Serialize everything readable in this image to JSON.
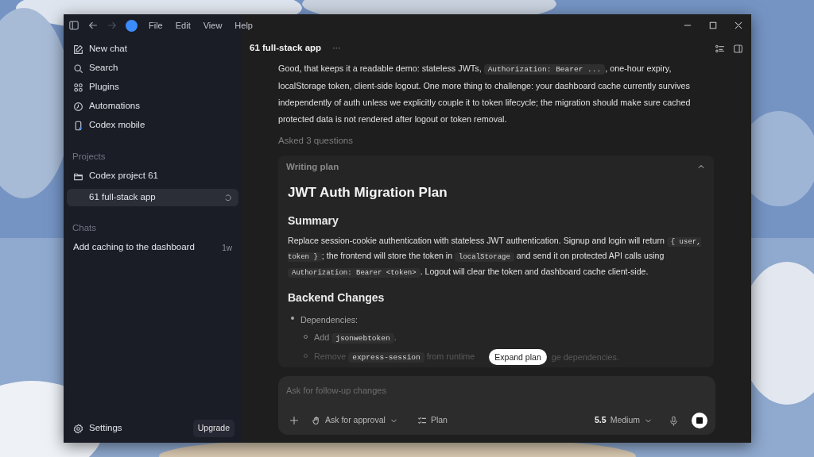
{
  "titlebar": {
    "nav_buttons": [
      {
        "kind": "back",
        "disabled": false
      },
      {
        "kind": "forward",
        "disabled": true
      }
    ],
    "menu": [
      "File",
      "Edit",
      "View",
      "Help"
    ]
  },
  "sidebar": {
    "items": [
      {
        "kind": "new-chat",
        "label": "New chat"
      },
      {
        "kind": "search",
        "label": "Search"
      },
      {
        "kind": "plugins",
        "label": "Plugins"
      },
      {
        "kind": "automations",
        "label": "Automations"
      },
      {
        "kind": "mobile",
        "label": "Codex mobile"
      }
    ],
    "projects": {
      "heading": "Projects",
      "items": [
        {
          "label": "Codex project 61",
          "selected": false,
          "children": [
            {
              "label": "61 full-stack app",
              "selected": true,
              "running": true
            }
          ]
        }
      ]
    },
    "chats": {
      "heading": "Chats",
      "items": [
        {
          "label": "Add caching to the dashboard",
          "time": "1w",
          "selected": false
        }
      ]
    },
    "settings": "Settings",
    "upgrade": "Upgrade"
  },
  "thread": {
    "title": "61 full-stack app",
    "more": "···",
    "message": [
      {
        "kind": "text",
        "text": "Good, that keeps it a readable demo: stateless JWTs, "
      },
      {
        "kind": "code",
        "text": "Authorization: Bearer ..."
      },
      {
        "kind": "text",
        "text": ", one-hour expiry, localStorage token, client-side logout. One more thing to challenge: your dashboard cache currently survives independently of auth unless we explicitly couple it to token lifecycle; the migration should make sure cached protected data is not rendered after logout or token removal."
      }
    ],
    "status": "Asked 3 questions",
    "plan": {
      "header": "Writing plan",
      "expand_button": "Expand plan",
      "blocks": [
        {
          "kind": "h1",
          "text": "JWT Auth Migration Plan"
        },
        {
          "kind": "h2",
          "text": "Summary"
        },
        {
          "kind": "p",
          "segments": [
            {
              "kind": "text",
              "text": "Replace session-cookie authentication with stateless JWT authentication. Signup and login will return "
            },
            {
              "kind": "code",
              "text": "{ user, token }"
            },
            {
              "kind": "text",
              "text": "; the frontend will store the token in "
            },
            {
              "kind": "code",
              "text": "localStorage"
            },
            {
              "kind": "text",
              "text": " and send it on protected API calls using "
            },
            {
              "kind": "code",
              "text": "Authorization: Bearer <token>"
            },
            {
              "kind": "text",
              "text": ". Logout will clear the token and dashboard cache client-side."
            }
          ]
        },
        {
          "kind": "h2",
          "text": "Backend Changes"
        },
        {
          "kind": "li",
          "segments": [
            {
              "kind": "text",
              "text": "Dependencies:"
            }
          ],
          "children": [
            {
              "segments": [
                {
                  "kind": "text",
                  "text": "Add "
                },
                {
                  "kind": "code",
                  "text": "jsonwebtoken"
                },
                {
                  "kind": "text",
                  "text": "."
                }
              ]
            },
            {
              "segments": [
                {
                  "kind": "text",
                  "text": "Remove "
                },
                {
                  "kind": "code",
                  "text": "express-session"
                },
                {
                  "kind": "text",
                  "text": " from runtime"
                }
              ],
              "tail": "ge dependencies."
            }
          ]
        }
      ]
    }
  },
  "composer": {
    "placeholder": "Ask for follow-up changes",
    "tools": [
      {
        "kind": "add"
      },
      {
        "kind": "approval",
        "label": "Ask for approval"
      },
      {
        "kind": "plan",
        "label": "Plan"
      }
    ],
    "model": {
      "version": "5.5",
      "effort": "Medium"
    }
  }
}
